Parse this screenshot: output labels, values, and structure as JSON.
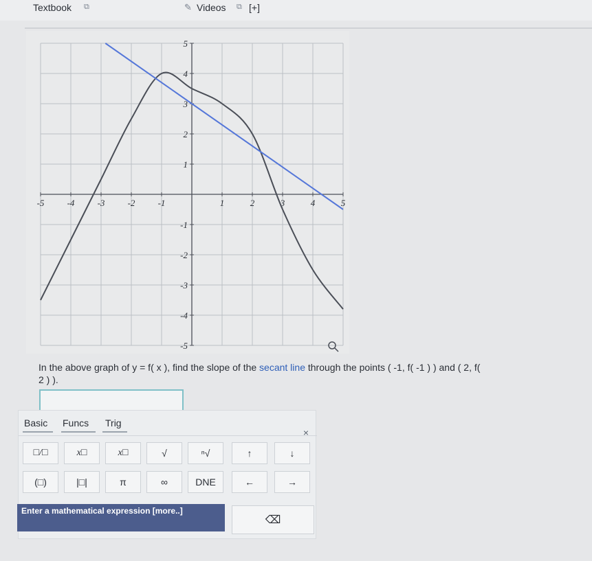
{
  "topbar": {
    "textbook_label": "Textbook",
    "videos_label": "Videos",
    "plus_label": "[+]"
  },
  "graph": {
    "x_ticks": [
      "-5",
      "-4",
      "-3",
      "-2",
      "-1",
      "1",
      "2",
      "3",
      "4",
      "5"
    ],
    "y_ticks": [
      "5",
      "4",
      "3",
      "2",
      "1",
      "-1",
      "-2",
      "-3",
      "-4",
      "-5"
    ],
    "colors": {
      "curve": "#4a4e57",
      "secant": "#5577d9",
      "grid": "#bcc0c5",
      "axis": "#4a4e57"
    }
  },
  "chart_data": {
    "type": "line",
    "xlim": [
      -5,
      5
    ],
    "ylim": [
      -5,
      5
    ],
    "grid": true,
    "series": [
      {
        "x": [
          -5,
          -4,
          -3,
          -2,
          -1,
          0,
          1,
          2,
          3,
          4,
          5
        ],
        "y": [
          -3.5,
          -1.5,
          0.5,
          2.5,
          4.0,
          3.5,
          3.0,
          2.0,
          -0.5,
          -2.5,
          -3.8
        ]
      },
      {
        "x": [
          -5,
          5
        ],
        "y": [
          6.5,
          -0.5
        ]
      }
    ]
  },
  "question": {
    "prefix": "In the above graph of ",
    "func": "y = f( x )",
    "mid": ", find the slope of the ",
    "secant": "secant line",
    "suffix": " through the points ( -1, f( -1 ) ) and ( 2, f(",
    "line2": "2 ) )."
  },
  "answer": {
    "value": ""
  },
  "keypad": {
    "tabs": [
      "Basic",
      "Funcs",
      "Trig"
    ],
    "close": "×",
    "row1": [
      "□/□",
      "x□",
      "x□",
      "√",
      "ⁿ√",
      "↑",
      "↓"
    ],
    "row2": [
      "(□)",
      "|□|",
      "π",
      "∞",
      "DNE",
      "←",
      "→"
    ],
    "hint": "Enter a mathematical expression [more..]",
    "backspace": "⌫"
  }
}
